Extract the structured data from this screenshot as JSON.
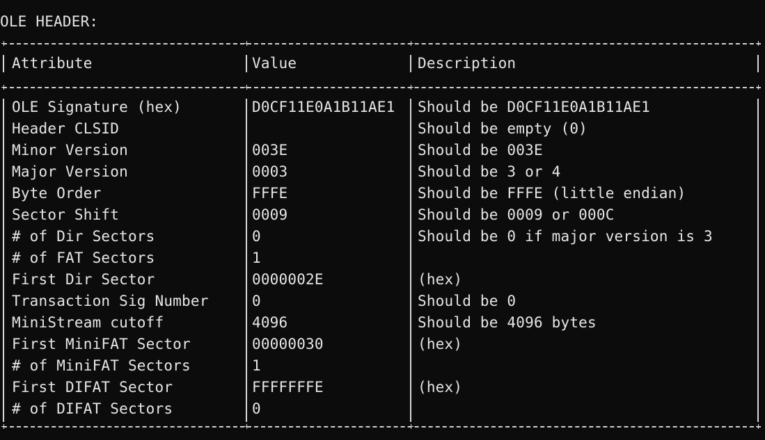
{
  "window": {
    "title": "OLE HEADER:"
  },
  "table": {
    "headers": [
      "Attribute",
      "Value",
      "Description"
    ],
    "rows": [
      [
        "OLE Signature (hex)",
        "D0CF11E0A1B11AE1",
        "Should be D0CF11E0A1B11AE1"
      ],
      [
        "Header CLSID",
        "",
        "Should be empty (0)"
      ],
      [
        "Minor Version",
        "003E",
        "Should be 003E"
      ],
      [
        "Major Version",
        "0003",
        "Should be 3 or 4"
      ],
      [
        "Byte Order",
        "FFFE",
        "Should be FFFE (little endian)"
      ],
      [
        "Sector Shift",
        "0009",
        "Should be 0009 or 000C"
      ],
      [
        "# of Dir Sectors",
        "0",
        "Should be 0 if major version is 3"
      ],
      [
        "# of FAT Sectors",
        "1",
        ""
      ],
      [
        "First Dir Sector",
        "0000002E",
        "(hex)"
      ],
      [
        "Transaction Sig Number",
        "0",
        "Should be 0"
      ],
      [
        "MiniStream cutoff",
        "4096",
        "Should be 4096 bytes"
      ],
      [
        "First MiniFAT Sector",
        "00000030",
        "(hex)"
      ],
      [
        "# of MiniFAT Sectors",
        "1",
        ""
      ],
      [
        "First DIFAT Sector",
        "FFFFFFFE",
        "(hex)"
      ],
      [
        "# of DIFAT Sectors",
        "0",
        ""
      ]
    ]
  },
  "colors": {
    "background": "#0c0c0c",
    "text": "#e6e6e6",
    "border": "#d8d8d8"
  }
}
